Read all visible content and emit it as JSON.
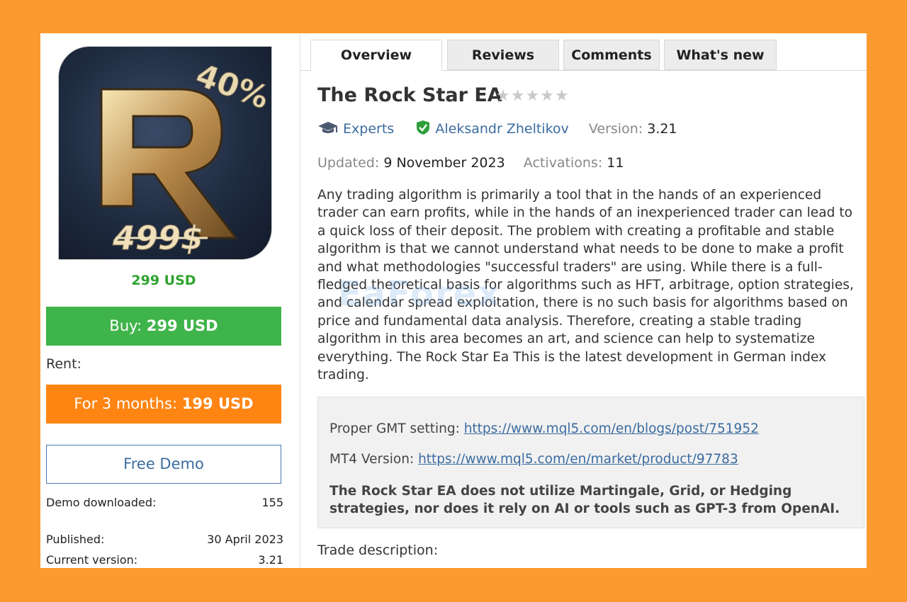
{
  "product": {
    "logo_text": "40%",
    "logo_price": "499$",
    "price": "299 USD",
    "buy_prefix": "Buy: ",
    "buy_amount": "299 USD",
    "rent_label": "Rent:",
    "rent_prefix": "For 3 months: ",
    "rent_amount": "199 USD",
    "demo_label": "Free Demo",
    "stats": [
      {
        "label": "Demo downloaded:",
        "value": "155"
      },
      {
        "label": "Published:",
        "value": "30 April 2023"
      },
      {
        "label": "Current version:",
        "value": "3.21"
      }
    ]
  },
  "tabs": [
    {
      "label": "Overview",
      "active": true
    },
    {
      "label": "Reviews",
      "active": false
    },
    {
      "label": "Comments",
      "active": false
    },
    {
      "label": "What's new",
      "active": false
    }
  ],
  "title": "The Rock Star EA",
  "stars": "★★★★★",
  "rating": 0,
  "meta": {
    "category": "Experts",
    "author": "Aleksandr Zheltikov",
    "version_label": "Version:",
    "version": "3.21",
    "updated_label": "Updated:",
    "updated": "9 November 2023",
    "activations_label": "Activations:",
    "activations": "11"
  },
  "description": "Any trading algorithm is primarily a tool that in the hands of an experienced trader can earn profits, while in the hands of an inexperienced trader can lead to a quick loss of their deposit. The problem with creating a profitable and stable algorithm is that we cannot understand what needs to be done to make a profit and what methodologies \"successful traders\" are using. While there is a full-fledged theoretical basis for algorithms such as HFT, arbitrage, option strategies, and calendar spread exploitation, there is no such basis for algorithms based on price and fundamental data analysis. Therefore, creating a stable trading algorithm in this area becomes an art, and science can help to systematize everything. The Rock Star Ea This is the latest development in German index trading.",
  "note": {
    "gmt_label": "Proper GMT setting: ",
    "gmt_link": "https://www.mql5.com/en/blogs/post/751952",
    "mt4_label": "MT4 Version: ",
    "mt4_link": "https://www.mql5.com/en/market/product/97783",
    "disclaimer": "The Rock Star EA does not utilize Martingale, Grid, or Hedging strategies, nor does it rely on AI or tools such as GPT-3 from OpenAI."
  },
  "trade_label": "Trade description:",
  "watermark": "EaForex",
  "colors": {
    "background": "#fb9a2f",
    "buy": "#3fb44a",
    "rent": "#ff8513",
    "link": "#3b6ca0",
    "price": "#2fa32f"
  }
}
